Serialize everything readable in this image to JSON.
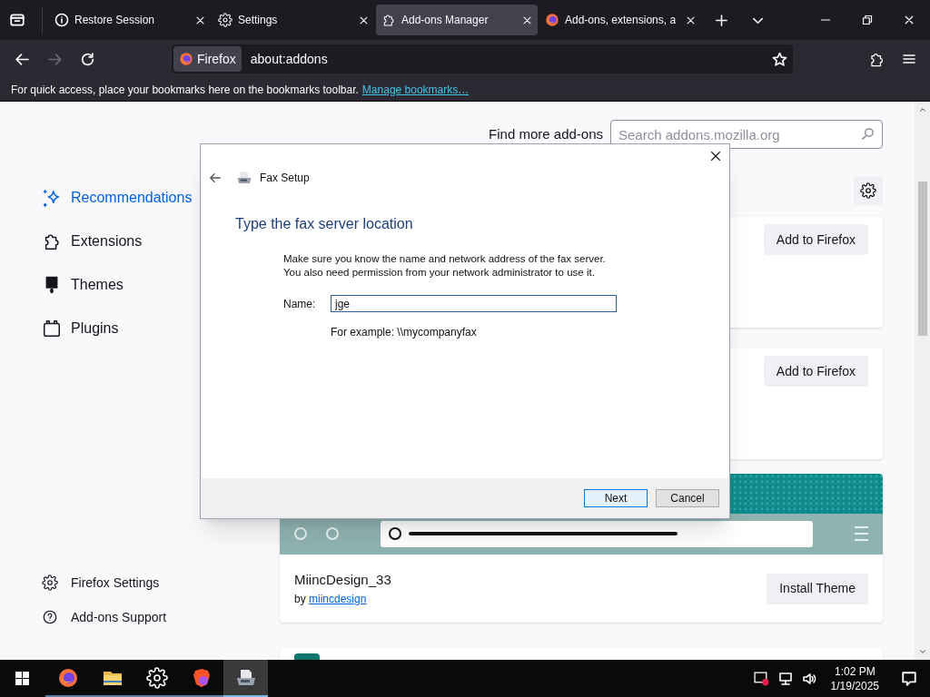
{
  "tabs": [
    {
      "kind": "info",
      "label": "Restore Session",
      "selected": false
    },
    {
      "kind": "gear",
      "label": "Settings",
      "selected": false
    },
    {
      "kind": "puzzle",
      "label": "Add-ons Manager",
      "selected": true
    },
    {
      "kind": "firefox",
      "label": "Add-ons, extensions, a",
      "selected": false
    }
  ],
  "toolbar": {
    "identity": "Firefox",
    "url": "about:addons",
    "forward_disabled": true
  },
  "bookmarks_bar": {
    "message": "For quick access, place your bookmarks here on the bookmarks toolbar.",
    "link": "Manage bookmarks…"
  },
  "sidebar": {
    "items": [
      {
        "kind": "sparkle",
        "label": "Recommendations",
        "selected": true
      },
      {
        "kind": "puzzle",
        "label": "Extensions",
        "selected": false
      },
      {
        "kind": "brush",
        "label": "Themes",
        "selected": false
      },
      {
        "kind": "plugin",
        "label": "Plugins",
        "selected": false
      }
    ],
    "footer": [
      {
        "kind": "gear",
        "label": "Firefox Settings"
      },
      {
        "kind": "help",
        "label": "Add-ons Support"
      }
    ]
  },
  "main": {
    "find_more": "Find more add-ons",
    "search": {
      "placeholder": "Search addons.mozilla.org"
    },
    "cards": [
      {
        "kind": "extension",
        "button": "Add to Firefox"
      },
      {
        "kind": "extension",
        "button": "Add to Firefox"
      },
      {
        "kind": "theme",
        "name": "MiincDesign_33",
        "by": "by",
        "author": "miincdesign",
        "button": "Install Theme"
      },
      {
        "kind": "partial"
      }
    ]
  },
  "dialog": {
    "title": "Fax Setup",
    "heading": "Type the fax server location",
    "description": "Make sure you know the name and network address of the fax server.\nYou also need permission from your network administrator to use it.",
    "name_label": "Name:",
    "name_value": "jge",
    "example": "For example: \\\\mycompanyfax",
    "buttons": [
      {
        "label": "Next",
        "default": true
      },
      {
        "label": "Cancel",
        "default": false
      }
    ]
  },
  "taskbar": {
    "apps": [
      {
        "kind": "firefox",
        "active": false
      },
      {
        "kind": "folder",
        "active": false
      },
      {
        "kind": "gear",
        "active": false
      },
      {
        "kind": "brave",
        "active": false
      },
      {
        "kind": "fax",
        "active": true
      }
    ],
    "time": "1:02 PM",
    "date": "1/19/2025"
  }
}
